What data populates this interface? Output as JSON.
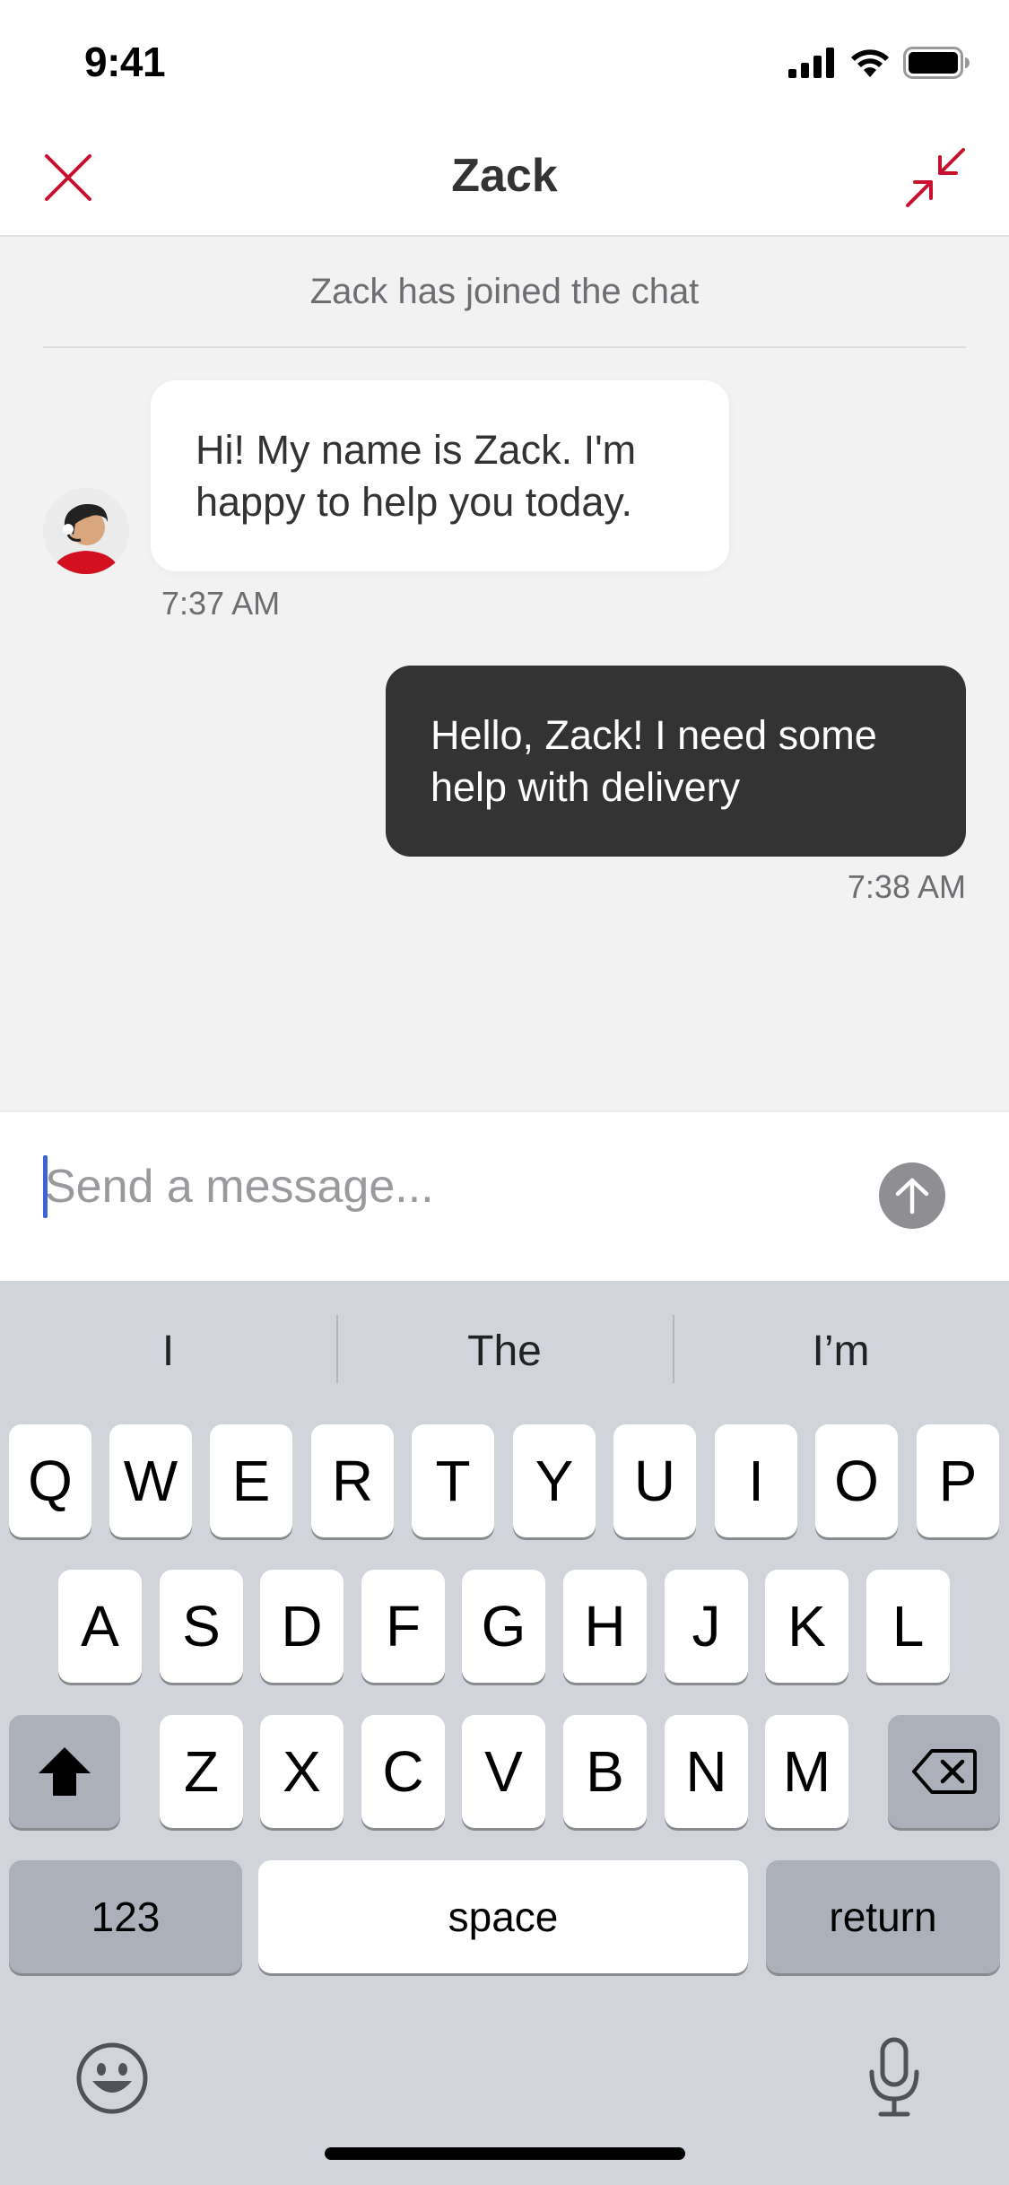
{
  "status_bar": {
    "time": "9:41"
  },
  "header": {
    "title": "Zack"
  },
  "chat": {
    "system_note": "Zack has joined the chat",
    "messages": [
      {
        "direction": "incoming",
        "text": "Hi! My name is Zack. I'm happy to help you today.",
        "time": "7:37 AM"
      },
      {
        "direction": "outgoing",
        "text": "Hello, Zack! I need some help with delivery",
        "time": "7:38 AM"
      }
    ]
  },
  "composer": {
    "placeholder": "Send a message..."
  },
  "keyboard": {
    "suggestions": [
      "I",
      "The",
      "I’m"
    ],
    "row1": [
      "Q",
      "W",
      "E",
      "R",
      "T",
      "Y",
      "U",
      "I",
      "O",
      "P"
    ],
    "row2": [
      "A",
      "S",
      "D",
      "F",
      "G",
      "H",
      "J",
      "K",
      "L"
    ],
    "row3": [
      "Z",
      "X",
      "C",
      "V",
      "B",
      "N",
      "M"
    ],
    "numbers_label": "123",
    "space_label": "space",
    "return_label": "return"
  },
  "colors": {
    "accent": "#c8102e",
    "outgoing_bubble": "#333333",
    "incoming_bubble": "#ffffff",
    "chat_background": "#f2f2f3",
    "keyboard_background": "#d1d4db"
  }
}
